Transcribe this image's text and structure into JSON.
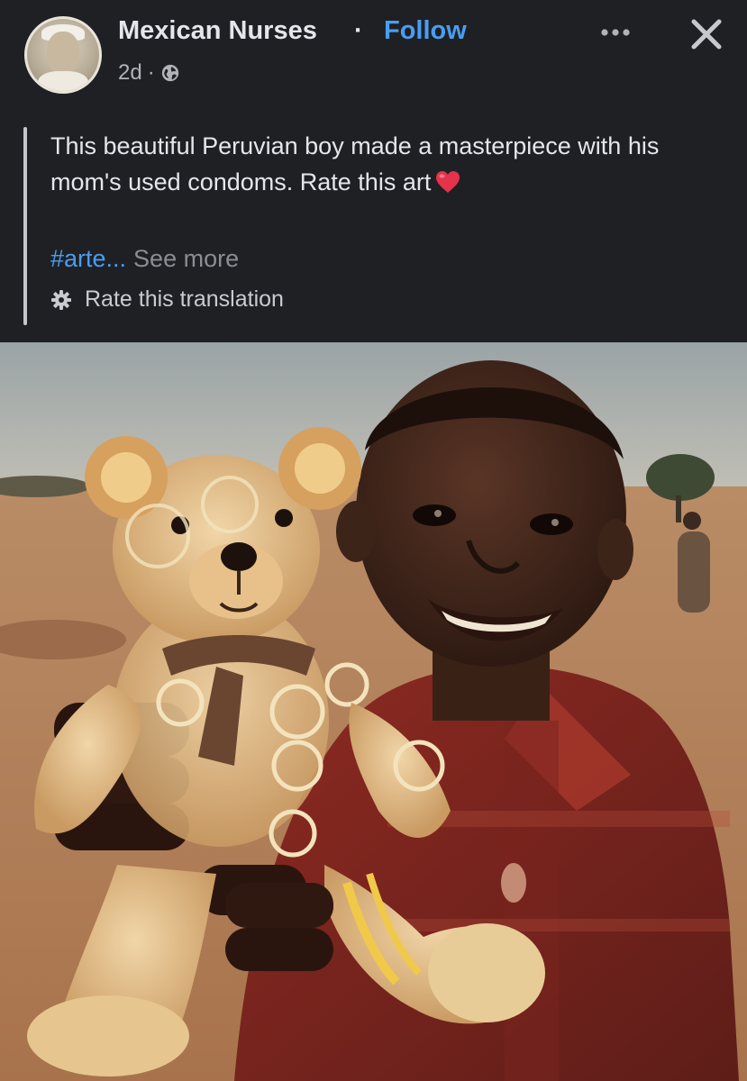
{
  "post": {
    "author": "Mexican Nurses",
    "separator": "·",
    "follow_label": "Follow",
    "time": "2d",
    "meta_separator": "·",
    "privacy_icon": "globe-icon",
    "text": "This beautiful Peruvian boy made a masterpiece with his mom's used condoms. Rate this art",
    "emoji": "heart-icon",
    "hashtag": "#arte...",
    "see_more_label": "See more",
    "translation_label": "Rate this translation"
  },
  "header_actions": {
    "more_icon": "more-icon",
    "close_icon": "close-icon"
  },
  "colors": {
    "background": "#1f2024",
    "link_blue": "#4a9df0",
    "text": "#e4e6eb",
    "muted": "#8a8d92",
    "heart": "#e5334b"
  }
}
